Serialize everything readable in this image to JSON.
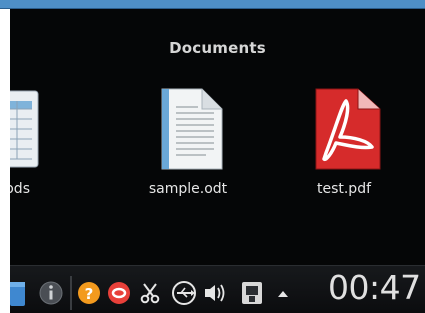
{
  "folder": {
    "title": "Documents"
  },
  "files": [
    {
      "name": "nple.ods",
      "icon": "spreadsheet-icon"
    },
    {
      "name": "sample.odt",
      "icon": "text-document-icon"
    },
    {
      "name": "test.pdf",
      "icon": "pdf-document-icon"
    }
  ],
  "taskbar": {
    "clock": "00:47",
    "tray_icons": [
      "window-icon",
      "info-icon",
      "help-icon",
      "sync-icon",
      "clipboard-scissors-icon",
      "usb-icon",
      "volume-icon",
      "device-notifier-icon",
      "tray-expand-arrow-icon"
    ]
  },
  "colors": {
    "background": "#050607",
    "accent_blue": "#4e8fc7",
    "pdf_red": "#d62b2b",
    "help_orange": "#f39a1e",
    "sync_red": "#e8403a"
  }
}
